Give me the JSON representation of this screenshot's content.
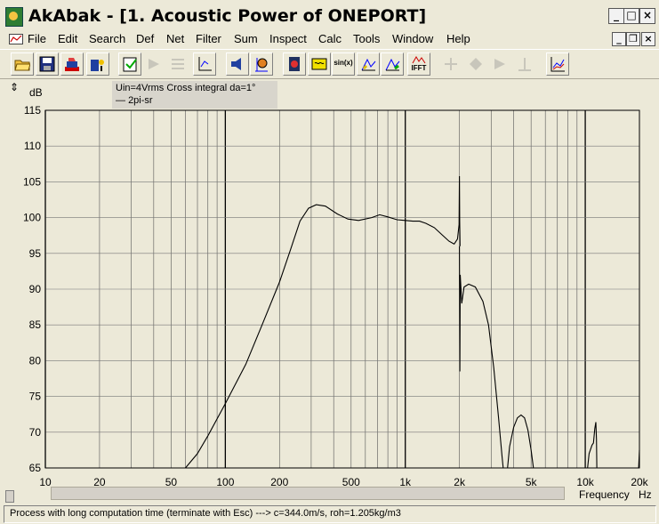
{
  "window": {
    "title": "AkAbak - [1. Acoustic Power of ONEPORT]",
    "controls": {
      "minimize": "_",
      "maximize": "□",
      "close": "×"
    },
    "doc_controls": {
      "minimize": "_",
      "restore": "❐",
      "close": "×"
    }
  },
  "menu": [
    "File",
    "Edit",
    "Search",
    "Def",
    "Net",
    "Filter",
    "Sum",
    "Inspect",
    "Calc",
    "Tools",
    "Window",
    "Help"
  ],
  "toolbar": {
    "buttons": [
      {
        "icon": "open-folder-icon",
        "enabled": true
      },
      {
        "icon": "save-disk-icon",
        "enabled": true
      },
      {
        "icon": "print-icon",
        "enabled": true
      },
      {
        "icon": "script-icon",
        "enabled": true
      },
      {
        "icon": "clipboard-icon",
        "enabled": true
      },
      {
        "icon": "arrow-icon",
        "enabled": false
      },
      {
        "icon": "grid-icon",
        "enabled": false
      },
      {
        "icon": "axis-scale-icon",
        "enabled": true
      },
      {
        "icon": "speaker-icon",
        "enabled": true
      },
      {
        "icon": "circle-target-icon",
        "enabled": true
      },
      {
        "icon": "driver-icon",
        "enabled": true
      },
      {
        "icon": "filter-icon",
        "enabled": true
      },
      {
        "icon": "sine-icon",
        "enabled": true,
        "label": "sin(x)"
      },
      {
        "icon": "response-icon",
        "enabled": true
      },
      {
        "icon": "response-2-icon",
        "enabled": true
      },
      {
        "icon": "ifft-icon",
        "enabled": true,
        "label": "IFFT"
      },
      {
        "icon": "nav-1-icon",
        "enabled": false
      },
      {
        "icon": "nav-2-icon",
        "enabled": false
      },
      {
        "icon": "nav-3-icon",
        "enabled": false
      },
      {
        "icon": "nav-4-icon",
        "enabled": false
      },
      {
        "icon": "graph-icon",
        "enabled": true
      }
    ]
  },
  "legend": {
    "title": "Uin=4Vrms Cross integral da=1°",
    "series_label": "2pi-sr"
  },
  "chart_data": {
    "type": "line",
    "title": "",
    "ylabel": "dB",
    "xlabel": "Frequency",
    "x_unit": "Hz",
    "x_scale": "log",
    "xlim": [
      10,
      20000
    ],
    "ylim": [
      65,
      115
    ],
    "y_ticks": [
      "115",
      "110",
      "105",
      "100",
      "95",
      "90",
      "85",
      "80",
      "75",
      "70",
      "65"
    ],
    "x_ticks": [
      {
        "v": 10,
        "label": "10"
      },
      {
        "v": 20,
        "label": "20"
      },
      {
        "v": 50,
        "label": "50"
      },
      {
        "v": 100,
        "label": "100"
      },
      {
        "v": 200,
        "label": "200"
      },
      {
        "v": 500,
        "label": "500"
      },
      {
        "v": 1000,
        "label": "1k"
      },
      {
        "v": 2000,
        "label": "2k"
      },
      {
        "v": 5000,
        "label": "5k"
      },
      {
        "v": 10000,
        "label": "10k"
      },
      {
        "v": 20000,
        "label": "20k"
      }
    ],
    "grid": true,
    "legend_position": "top-left",
    "series": [
      {
        "name": "2pi-sr",
        "color": "#000000",
        "segments": [
          [
            [
              60,
              65
            ],
            [
              70,
              67
            ],
            [
              80,
              69.5
            ],
            [
              100,
              74
            ],
            [
              130,
              79.5
            ],
            [
              160,
              85
            ],
            [
              200,
              91
            ],
            [
              230,
              95.5
            ],
            [
              260,
              99.5
            ],
            [
              290,
              101.3
            ],
            [
              320,
              101.8
            ],
            [
              360,
              101.6
            ],
            [
              420,
              100.5
            ],
            [
              480,
              99.8
            ],
            [
              550,
              99.6
            ],
            [
              650,
              100
            ],
            [
              720,
              100.4
            ],
            [
              800,
              100.1
            ],
            [
              900,
              99.7
            ],
            [
              1000,
              99.6
            ],
            [
              1100,
              99.5
            ],
            [
              1200,
              99.5
            ],
            [
              1300,
              99.2
            ],
            [
              1450,
              98.6
            ],
            [
              1600,
              97.6
            ],
            [
              1750,
              96.7
            ],
            [
              1870,
              96.3
            ],
            [
              1950,
              97
            ],
            [
              1990,
              99
            ],
            [
              2000,
              105.8
            ],
            [
              2005,
              99.5
            ],
            [
              2015,
              96
            ]
          ],
          [
            [
              2000,
              96
            ],
            [
              2010,
              78.5
            ],
            [
              2020,
              92
            ],
            [
              2060,
              88
            ],
            [
              2120,
              90.3
            ],
            [
              2250,
              90.7
            ],
            [
              2450,
              90.3
            ],
            [
              2700,
              88.3
            ],
            [
              2900,
              85
            ],
            [
              3100,
              79
            ],
            [
              3300,
              72
            ],
            [
              3450,
              66.5
            ],
            [
              3500,
              65
            ]
          ],
          [
            [
              3700,
              65
            ],
            [
              3800,
              68
            ],
            [
              4000,
              70.7
            ],
            [
              4200,
              72
            ],
            [
              4400,
              72.4
            ],
            [
              4600,
              72
            ],
            [
              4800,
              70.3
            ],
            [
              5000,
              67.5
            ],
            [
              5150,
              65
            ]
          ],
          [
            [
              10300,
              65
            ],
            [
              10500,
              67
            ],
            [
              10900,
              68.2
            ],
            [
              11100,
              68.5
            ],
            [
              11300,
              70.5
            ],
            [
              11450,
              71.4
            ],
            [
              11550,
              69
            ],
            [
              11600,
              65
            ]
          ],
          [
            [
              19800,
              65
            ],
            [
              20000,
              67.5
            ]
          ]
        ]
      }
    ]
  },
  "scrollbar": {
    "left_label": "Frequency",
    "unit_label": "Hz"
  },
  "side_label": "⇕",
  "status": "Process with long computation time (terminate with Esc) ---> c=344.0m/s, roh=1.205kg/m3"
}
